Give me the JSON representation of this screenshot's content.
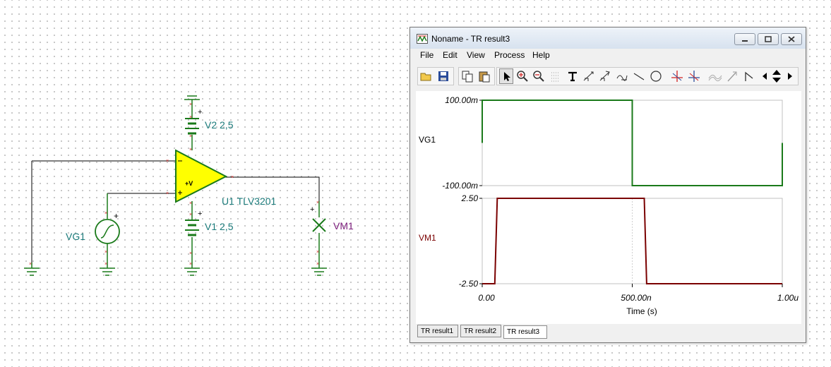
{
  "schematic": {
    "components": [
      {
        "id": "V2",
        "label": "V2 2,5"
      },
      {
        "id": "V1",
        "label": "V1 2,5"
      },
      {
        "id": "U1",
        "label": "U1 TLV3201",
        "supply_label": "+V"
      },
      {
        "id": "VG1",
        "label": "VG1"
      },
      {
        "id": "VM1",
        "label": "VM1"
      }
    ],
    "symbols": {
      "plus": "+",
      "minus": "-"
    }
  },
  "window": {
    "title": "Noname - TR result3",
    "controls": [
      "minimize",
      "maximize",
      "close"
    ]
  },
  "menu": [
    "File",
    "Edit",
    "View",
    "Process",
    "Help"
  ],
  "toolbar": {
    "icons": [
      "open-folder",
      "save",
      "copy",
      "paste",
      "pointer",
      "zoom-in",
      "zoom-100",
      "grid",
      "text",
      "cursor-a",
      "cursor-b",
      "cursor-c",
      "line",
      "circle",
      "marker-a",
      "marker-b",
      "wave",
      "arrow",
      "flag",
      "scroll-left",
      "scroll-up-down",
      "scroll-right"
    ]
  },
  "chart_data": [
    {
      "type": "line",
      "series": [
        {
          "name": "VG1",
          "color": "#1a7a1a",
          "x": [
            0,
            0,
            500,
            500,
            1000,
            1000
          ],
          "y": [
            0,
            100,
            100,
            -100,
            -100,
            0
          ]
        }
      ],
      "ylim": [
        -100,
        100
      ],
      "ytick_labels": [
        "100.00m",
        "-100.00m"
      ],
      "xlim": [
        0,
        1000
      ]
    },
    {
      "type": "line",
      "series": [
        {
          "name": "VM1",
          "color": "#7a0000",
          "x": [
            0,
            42,
            50,
            540,
            548,
            1000
          ],
          "y": [
            -2.5,
            -2.5,
            2.5,
            2.5,
            -2.5,
            -2.5
          ]
        }
      ],
      "ylim": [
        -2.5,
        2.5
      ],
      "ytick_labels": [
        "2.50",
        "-2.50"
      ],
      "xlim": [
        0,
        1000
      ],
      "xtick_labels": [
        "0.00",
        "500.00n",
        "1.00u"
      ],
      "xlabel": "Time (s)"
    }
  ],
  "tabs": [
    {
      "label": "TR result1",
      "active": false
    },
    {
      "label": "TR result2",
      "active": false
    },
    {
      "label": "TR result3",
      "active": true
    }
  ]
}
